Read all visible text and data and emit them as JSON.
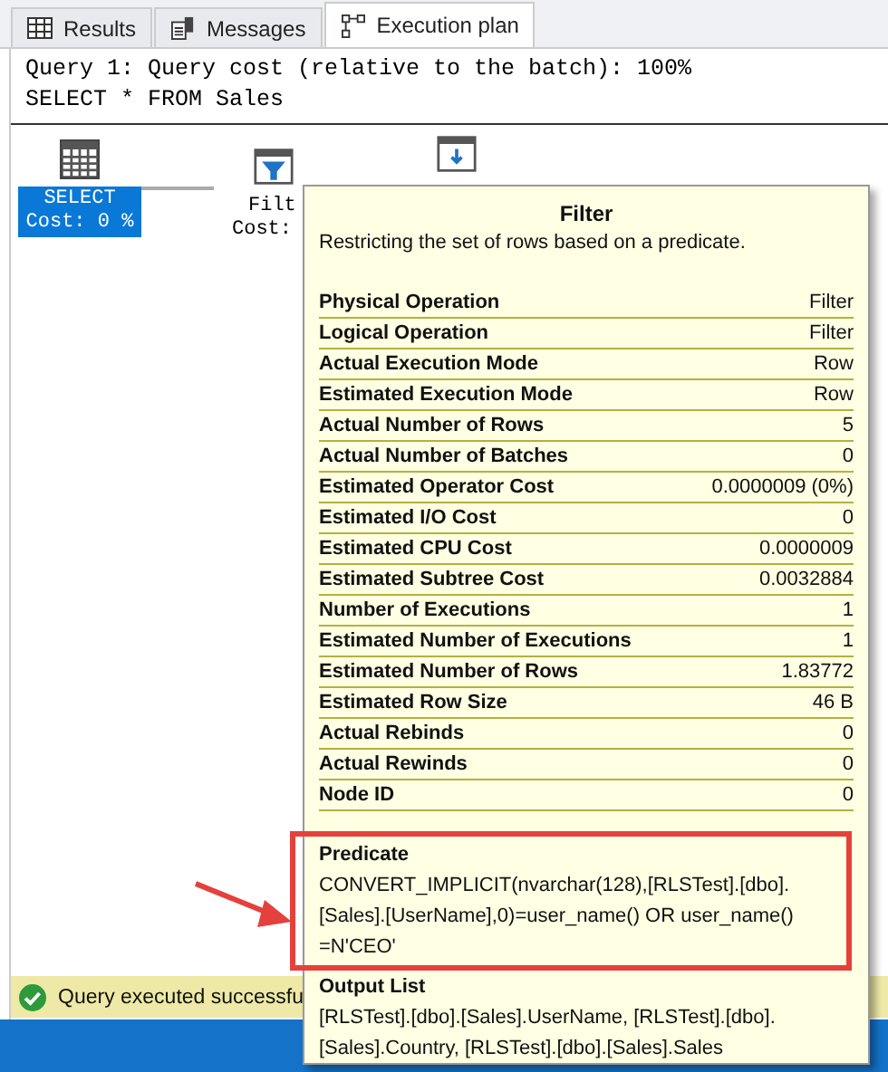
{
  "tabs": [
    {
      "label": "Results",
      "kind": "grid",
      "selected": false
    },
    {
      "label": "Messages",
      "kind": "messages",
      "selected": false
    },
    {
      "label": "Execution plan",
      "kind": "plan",
      "selected": true
    }
  ],
  "query_text": [
    "Query 1: Query cost (relative to the batch): 100%",
    "SELECT * FROM Sales"
  ],
  "plan_nodes": [
    {
      "kind": "select",
      "label": "SELECT",
      "cost": "Cost: 0 %",
      "selected": true
    },
    {
      "kind": "filter",
      "label": "Filt",
      "cost": "Cost:",
      "selected": false
    },
    {
      "kind": "table_scan"
    }
  ],
  "tooltip": {
    "title": "Filter",
    "description": "Restricting the set of rows based on a predicate.",
    "properties": [
      {
        "name": "Physical Operation",
        "value": "Filter"
      },
      {
        "name": "Logical Operation",
        "value": "Filter"
      },
      {
        "name": "Actual Execution Mode",
        "value": "Row"
      },
      {
        "name": "Estimated Execution Mode",
        "value": "Row"
      },
      {
        "name": "Actual Number of Rows",
        "value": "5"
      },
      {
        "name": "Actual Number of Batches",
        "value": "0"
      },
      {
        "name": "Estimated Operator Cost",
        "value": "0.0000009 (0%)"
      },
      {
        "name": "Estimated I/O Cost",
        "value": "0"
      },
      {
        "name": "Estimated CPU Cost",
        "value": "0.0000009"
      },
      {
        "name": "Estimated Subtree Cost",
        "value": "0.0032884"
      },
      {
        "name": "Number of Executions",
        "value": "1"
      },
      {
        "name": "Estimated Number of Executions",
        "value": "1"
      },
      {
        "name": "Estimated Number of Rows",
        "value": "1.83772"
      },
      {
        "name": "Estimated Row Size",
        "value": "46 B"
      },
      {
        "name": "Actual Rebinds",
        "value": "0"
      },
      {
        "name": "Actual Rewinds",
        "value": "0"
      },
      {
        "name": "Node ID",
        "value": "0"
      }
    ],
    "sections": [
      {
        "heading": "Predicate",
        "lines": [
          "CONVERT_IMPLICIT(nvarchar(128),[RLSTest].[dbo].",
          "[Sales].[UserName],0)=user_name() OR user_name()",
          "=N'CEO'"
        ],
        "highlighted": true
      },
      {
        "heading": "Output List",
        "lines": [
          "[RLSTest].[dbo].[Sales].UserName, [RLSTest].[dbo].",
          "[Sales].Country, [RLSTest].[dbo].[Sales].Sales"
        ],
        "highlighted": false
      }
    ]
  },
  "status_bar": {
    "text": "Query executed successfu"
  }
}
